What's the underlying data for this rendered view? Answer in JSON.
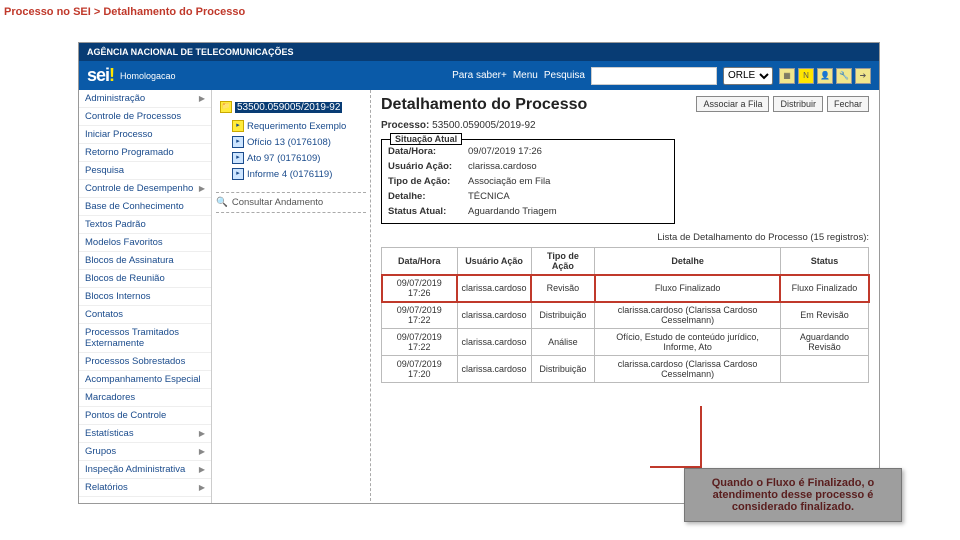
{
  "breadcrumb": "Processo no SEI > Detalhamento do Processo",
  "agency": "AGÊNCIA NACIONAL DE TELECOMUNICAÇÕES",
  "logo_a": "sei",
  "logo_b": "!",
  "env": "Homologacao",
  "top": {
    "saber": "Para saber+",
    "menu": "Menu",
    "pesquisa": "Pesquisa",
    "unit": "ORLE"
  },
  "sidebar": [
    "Administração",
    "Controle de Processos",
    "Iniciar Processo",
    "Retorno Programado",
    "Pesquisa",
    "Controle de Desempenho",
    "Base de Conhecimento",
    "Textos Padrão",
    "Modelos Favoritos",
    "Blocos de Assinatura",
    "Blocos de Reunião",
    "Blocos Internos",
    "Contatos",
    "Processos Tramitados Externamente",
    "Processos Sobrestados",
    "Acompanhamento Especial",
    "Marcadores",
    "Pontos de Controle",
    "Estatísticas",
    "Grupos",
    "Inspeção Administrativa",
    "Relatórios"
  ],
  "sidebar_caret": [
    0,
    5,
    18,
    19,
    20,
    21
  ],
  "tree": {
    "root": "53500.059005/2019-92",
    "items": [
      "Requerimento Exemplo",
      "Ofício 13 (0176108)",
      "Ato 97 (0176109)",
      "Informe 4 (0176119)"
    ],
    "consult": "Consultar Andamento"
  },
  "page_title": "Detalhamento do Processo",
  "actions": [
    "Associar a Fila",
    "Distribuir",
    "Fechar"
  ],
  "proc_lbl": "Processo:",
  "proc_num": "53500.059005/2019-92",
  "sit": {
    "legend": "Situação Atual",
    "rows": [
      [
        "Data/Hora:",
        "09/07/2019 17:26"
      ],
      [
        "Usuário Ação:",
        "clarissa.cardoso"
      ],
      [
        "Tipo de Ação:",
        "Associação em Fila"
      ],
      [
        "Detalhe:",
        "TÉCNICA"
      ],
      [
        "Status Atual:",
        "Aguardando Triagem"
      ]
    ]
  },
  "list_caption": "Lista de Detalhamento do Processo (15 registros):",
  "thead": [
    "Data/Hora",
    "Usuário Ação",
    "Tipo de Ação",
    "Detalhe",
    "Status"
  ],
  "rows": [
    [
      "09/07/2019 17:26",
      "clarissa.cardoso",
      "Revisão",
      "Fluxo Finalizado",
      "Fluxo Finalizado"
    ],
    [
      "09/07/2019 17:22",
      "clarissa.cardoso",
      "Distribuição",
      "clarissa.cardoso (Clarissa Cardoso Cesselmann)",
      "Em Revisão"
    ],
    [
      "09/07/2019 17:22",
      "clarissa.cardoso",
      "Análise",
      "Ofício, Estudo de conteúdo jurídico, Informe, Ato",
      "Aguardando Revisão"
    ],
    [
      "09/07/2019 17:20",
      "clarissa.cardoso",
      "Distribuição",
      "clarissa.cardoso (Clarissa Cardoso Cesselmann)",
      ""
    ]
  ],
  "callout": "Quando o Fluxo é Finalizado, o atendimento desse processo é considerado finalizado."
}
